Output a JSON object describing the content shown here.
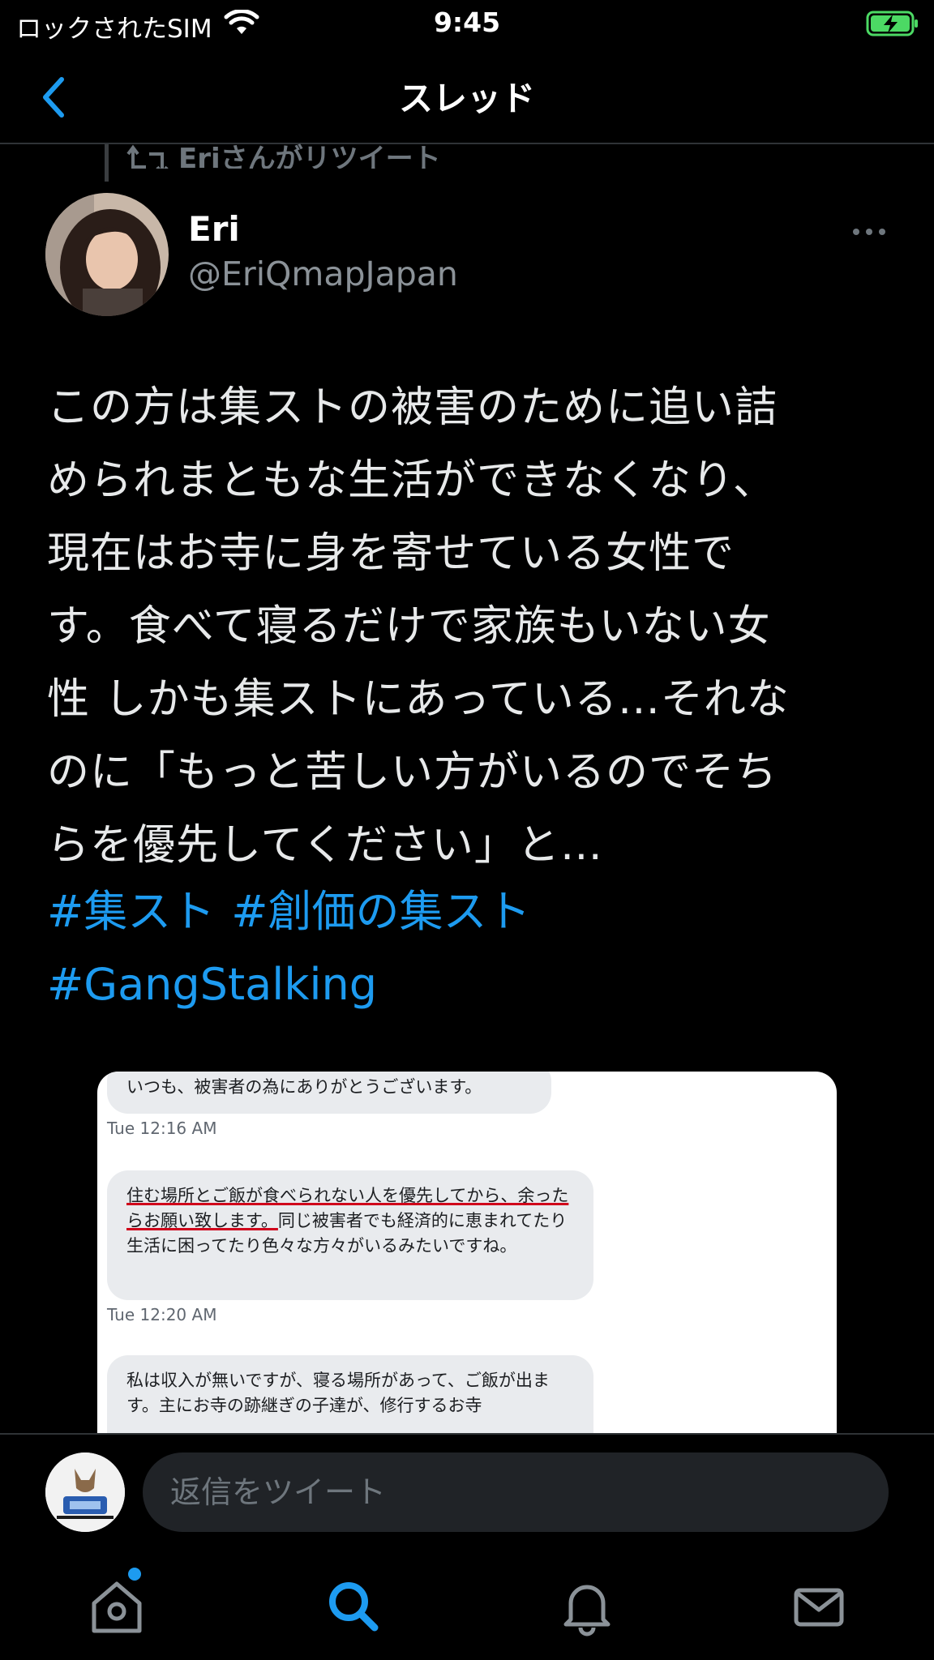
{
  "status_bar": {
    "carrier": "ロックされたSIM",
    "time": "9:45"
  },
  "nav": {
    "title": "スレッド"
  },
  "tweet": {
    "retweet_label": "Eriさんがリツイート",
    "display_name": "Eri",
    "handle": "@EriQmapJapan",
    "text_lines": [
      "この方は集ストの被害のために追い詰",
      "められまともな生活ができなくなり、",
      "現在はお寺に身を寄せている女性で",
      "す。食べて寝るだけで家族もいない女",
      "性 しかも集ストにあっている…それな",
      "のに「もっと苦しい方がいるのでそち",
      "らを優先してください」と…"
    ],
    "hashtags": [
      "#集スト",
      "#創価の集スト",
      "#GangStalking"
    ]
  },
  "media": {
    "messages": [
      {
        "text": "いつも、被害者の為にありがとうございます。",
        "time": "Tue 12:16 AM"
      },
      {
        "text_underlined": "住む場所とご飯が食べられない人を優先してから、余ったらお願い致します。",
        "text_rest": "同じ被害者でも経済的に恵まれてたり生活に困ってたり色々な方々がいるみたいですね。",
        "time": "Tue 12:20 AM"
      },
      {
        "text": "私は収入が無いですが、寝る場所があって、ご飯が出ます。主にお寺の跡継ぎの子達が、修行するお寺"
      }
    ]
  },
  "reply": {
    "placeholder": "返信をツイート"
  },
  "tabs": [
    "home-icon",
    "search-icon",
    "bell-icon",
    "mail-icon"
  ],
  "colors": {
    "accent": "#1d9bf0",
    "battery": "#4cd964",
    "background": "#000000"
  }
}
